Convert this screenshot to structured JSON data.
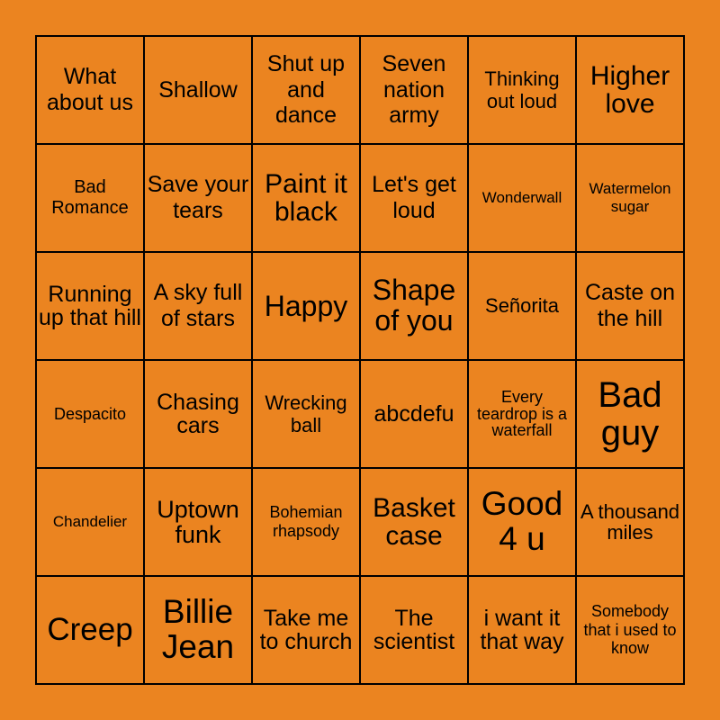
{
  "board": {
    "background_color": "#EB8420",
    "rows": [
      [
        "What about us",
        "Shallow",
        "Shut up and dance",
        "Seven nation army",
        "Thinking out loud",
        "Higher love"
      ],
      [
        "Bad Romance",
        "Save your tears",
        "Paint it black",
        "Let's get loud",
        "Wonderwall",
        "Watermelon sugar"
      ],
      [
        "Running up that hill",
        "A sky full of stars",
        "Happy",
        "Shape of you",
        "Señorita",
        "Caste on the hill"
      ],
      [
        "Despacito",
        "Chasing cars",
        "Wrecking ball",
        "abcdefu",
        "Every teardrop is a waterfall",
        "Bad guy"
      ],
      [
        "Chandelier",
        "Uptown funk",
        "Bohemian rhapsody",
        "Basket case",
        "Good 4 u",
        "A thousand miles"
      ],
      [
        "Creep",
        "Billie Jean",
        "Take me to church",
        "The scientist",
        "i want it that way",
        "Somebody that i used to know"
      ]
    ]
  }
}
